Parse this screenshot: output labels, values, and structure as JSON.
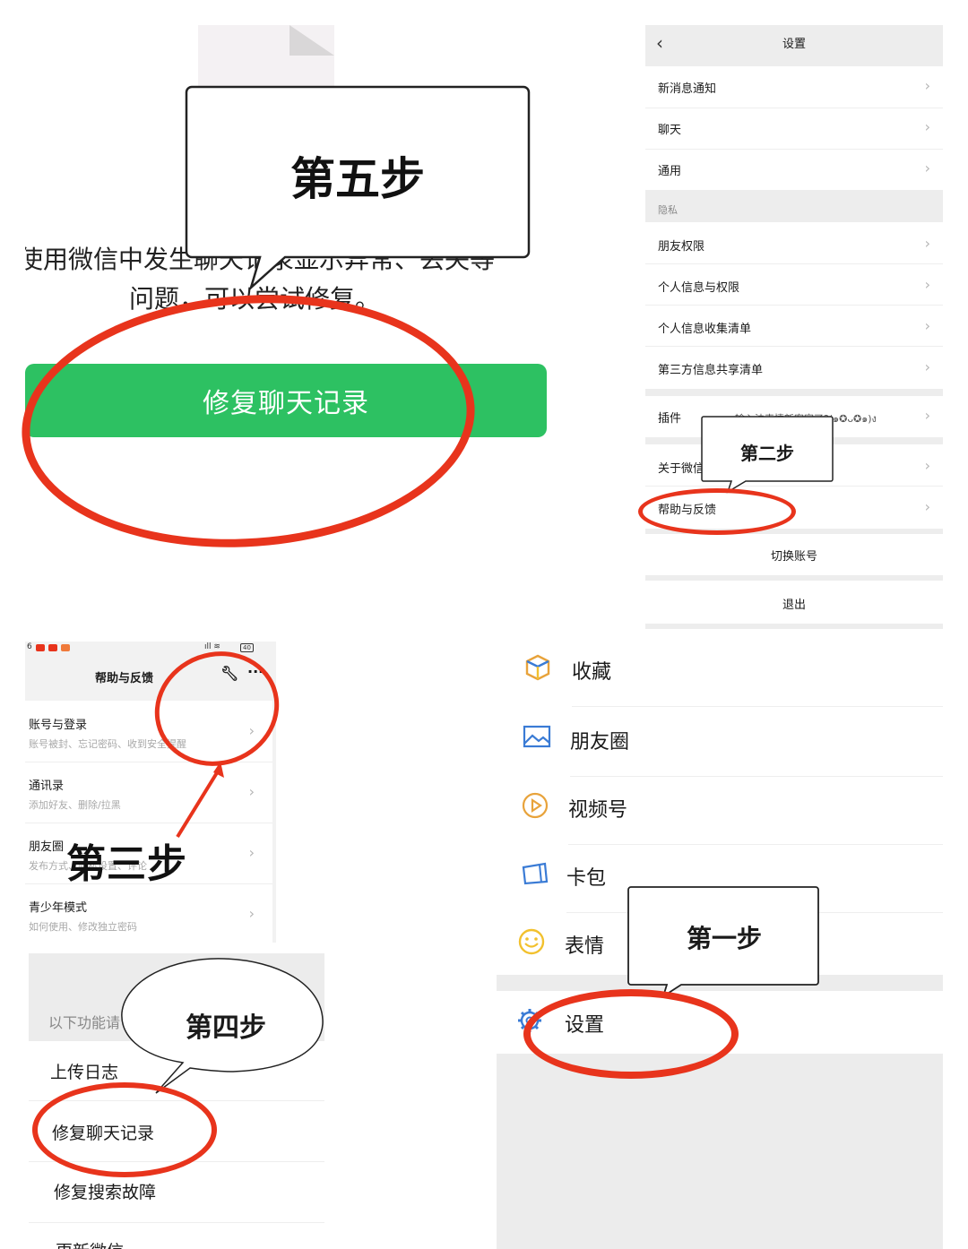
{
  "panel_fix": {
    "description_lines": [
      "使用微信中发生聊天记录显示异常、丢失等",
      "问题，可以尝试修复。"
    ],
    "fix_button_label": "修复聊天记录",
    "step_label": "第五步"
  },
  "panel_settings": {
    "title": "设置",
    "rows_top": [
      "新消息通知",
      "聊天",
      "通用"
    ],
    "section_privacy": "隐私",
    "rows_privacy": [
      "朋友权限",
      "个人信息与权限",
      "个人信息收集清单",
      "第三方信息共享清单"
    ],
    "plugin_label": "插件",
    "plugin_value": "输入法表情新客官了?(๑✪ᴗ✪๑)ง",
    "about_label": "关于微信",
    "help_label": "帮助与反馈",
    "switch_account": "切换账号",
    "logout": "退出",
    "step_label": "第二步"
  },
  "panel_help": {
    "status_left": "6",
    "battery": "40",
    "title": "帮助与反馈",
    "items": [
      {
        "title": "账号与登录",
        "sub": "账号被封、忘记密码、收到安全提醒"
      },
      {
        "title": "通讯录",
        "sub": "添加好友、删除/拉黑"
      },
      {
        "title": "朋友圈",
        "sub": "发布方式、隐私设置、评论"
      },
      {
        "title": "青少年模式",
        "sub": "如何使用、修改独立密码"
      }
    ],
    "step_label": "第三步"
  },
  "panel_tools": {
    "section_label": "以下功能请",
    "items": [
      "上传日志",
      "修复聊天记录",
      "修复搜索故障",
      "更新微信"
    ],
    "step_label": "第四步"
  },
  "panel_me": {
    "items": [
      {
        "label": "收藏",
        "icon": "cube-icon",
        "color": "#e8a33b"
      },
      {
        "label": "朋友圈",
        "icon": "image-icon",
        "color": "#3a7bd5"
      },
      {
        "label": "视频号",
        "icon": "play-circle-icon",
        "color": "#e8a33b"
      },
      {
        "label": "卡包",
        "icon": "card-wallet-icon",
        "color": "#3a7bd5"
      },
      {
        "label": "表情",
        "icon": "smile-icon",
        "color": "#f2c12e"
      },
      {
        "label": "设置",
        "icon": "gear-icon",
        "color": "#3a7bd5"
      }
    ],
    "step_label": "第一步"
  },
  "colors": {
    "accent_green": "#2dc162",
    "highlight_red": "#e8341c"
  }
}
